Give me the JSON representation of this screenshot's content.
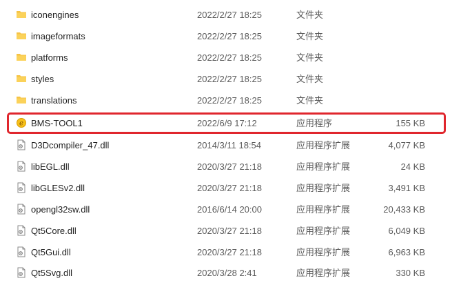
{
  "files": [
    {
      "name": "iconengines",
      "date": "2022/2/27 18:25",
      "type": "文件夹",
      "size": "",
      "icon": "folder-icon"
    },
    {
      "name": "imageformats",
      "date": "2022/2/27 18:25",
      "type": "文件夹",
      "size": "",
      "icon": "folder-icon"
    },
    {
      "name": "platforms",
      "date": "2022/2/27 18:25",
      "type": "文件夹",
      "size": "",
      "icon": "folder-icon"
    },
    {
      "name": "styles",
      "date": "2022/2/27 18:25",
      "type": "文件夹",
      "size": "",
      "icon": "folder-icon"
    },
    {
      "name": "translations",
      "date": "2022/2/27 18:25",
      "type": "文件夹",
      "size": "",
      "icon": "folder-icon"
    },
    {
      "name": "BMS-TOOL1",
      "date": "2022/6/9 17:12",
      "type": "应用程序",
      "size": "155 KB",
      "icon": "app-icon"
    },
    {
      "name": "D3Dcompiler_47.dll",
      "date": "2014/3/11 18:54",
      "type": "应用程序扩展",
      "size": "4,077 KB",
      "icon": "dll-icon"
    },
    {
      "name": "libEGL.dll",
      "date": "2020/3/27 21:18",
      "type": "应用程序扩展",
      "size": "24 KB",
      "icon": "dll-icon"
    },
    {
      "name": "libGLESv2.dll",
      "date": "2020/3/27 21:18",
      "type": "应用程序扩展",
      "size": "3,491 KB",
      "icon": "dll-icon"
    },
    {
      "name": "opengl32sw.dll",
      "date": "2016/6/14 20:00",
      "type": "应用程序扩展",
      "size": "20,433 KB",
      "icon": "dll-icon"
    },
    {
      "name": "Qt5Core.dll",
      "date": "2020/3/27 21:18",
      "type": "应用程序扩展",
      "size": "6,049 KB",
      "icon": "dll-icon"
    },
    {
      "name": "Qt5Gui.dll",
      "date": "2020/3/27 21:18",
      "type": "应用程序扩展",
      "size": "6,963 KB",
      "icon": "dll-icon"
    },
    {
      "name": "Qt5Svg.dll",
      "date": "2020/3/28 2:41",
      "type": "应用程序扩展",
      "size": "330 KB",
      "icon": "dll-icon"
    }
  ],
  "highlight_color": "#e0262d",
  "folder_color": "#f6c344"
}
